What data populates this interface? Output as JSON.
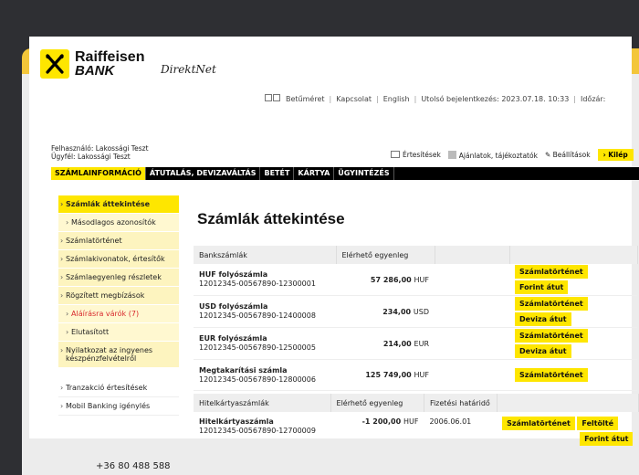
{
  "header": {
    "logo_line1": "Raiffeisen",
    "logo_line2": "BANK",
    "product": "DirektNet"
  },
  "topnav": {
    "items": [
      "Betűméret",
      "Kapcsolat",
      "English",
      "Utolsó bejelentkezés: 2023.07.18. 10:33",
      "Időzár:"
    ]
  },
  "user": {
    "felhasznalo": "Felhasználó: Lakossági Teszt",
    "ugyfel": "Ügyfél: Lakossági Teszt"
  },
  "actions": {
    "ertesitesek": "Értesítések",
    "ajanlatok": "Ajánlatok, tájékoztatók",
    "beallitasok": "Beállítások",
    "kilep": "› Kilép"
  },
  "mainnav": [
    "SZÁMLAINFORMÁCIÓ",
    "ÁTUTALÁS, DEVIZAVÁLTÁS",
    "BETÉT",
    "KÁRTYA",
    "ÜGYINTÉZÉS"
  ],
  "sidebar": {
    "items": [
      "Számlák áttekintése",
      "Másodlagos azonosítók",
      "Számlatörténet",
      "Számlakivonatok, értesítők",
      "Számlaegyenleg részletek",
      "Rögzített megbízások",
      "Aláírásra várók (7)",
      "Elutasított",
      "Nyilatkozat az ingyenes készpénzfelvételről",
      "Tranzakció értesítések",
      "Mobil Banking igénylés"
    ],
    "phone": "+36 80 488 588"
  },
  "main": {
    "title": "Számlák áttekintése",
    "bank_table": {
      "headers": [
        "Bankszámlák",
        "Elérhető egyenleg"
      ],
      "rows": [
        {
          "name": "HUF folyószámla",
          "number": "12012345-00567890-12300001",
          "amount": "57 286,00",
          "currency": "HUF",
          "btn1": "Számlatörténet",
          "btn2": "Forint átut"
        },
        {
          "name": "USD folyószámla",
          "number": "12012345-00567890-12400008",
          "amount": "234,00",
          "currency": "USD",
          "btn1": "Számlatörténet",
          "btn2": "Deviza átut"
        },
        {
          "name": "EUR folyószámla",
          "number": "12012345-00567890-12500005",
          "amount": "214,00",
          "currency": "EUR",
          "btn1": "Számlatörténet",
          "btn2": "Deviza átut"
        },
        {
          "name": "Megtakarítási számla",
          "number": "12012345-00567890-12800006",
          "amount": "125 749,00",
          "currency": "HUF",
          "btn1": "Számlatörténet"
        }
      ]
    },
    "credit_table": {
      "headers": [
        "Hitelkártyaszámlák",
        "Elérhető egyenleg",
        "Fizetési határidő"
      ],
      "rows": [
        {
          "name": "Hitelkártyaszámla",
          "number": "12012345-00567890-12700009",
          "amount": "-1 200,00",
          "currency": "HUF",
          "deadline": "2006.06.01",
          "btn1": "Számlatörténet",
          "btn2": "Feltölté",
          "btn3": "Forint átut"
        }
      ]
    }
  },
  "colors": {
    "brand_yellow": "#fee600",
    "window_frame": "#f3c63a",
    "nav_black": "#000000",
    "alert_red": "#d8282c"
  }
}
